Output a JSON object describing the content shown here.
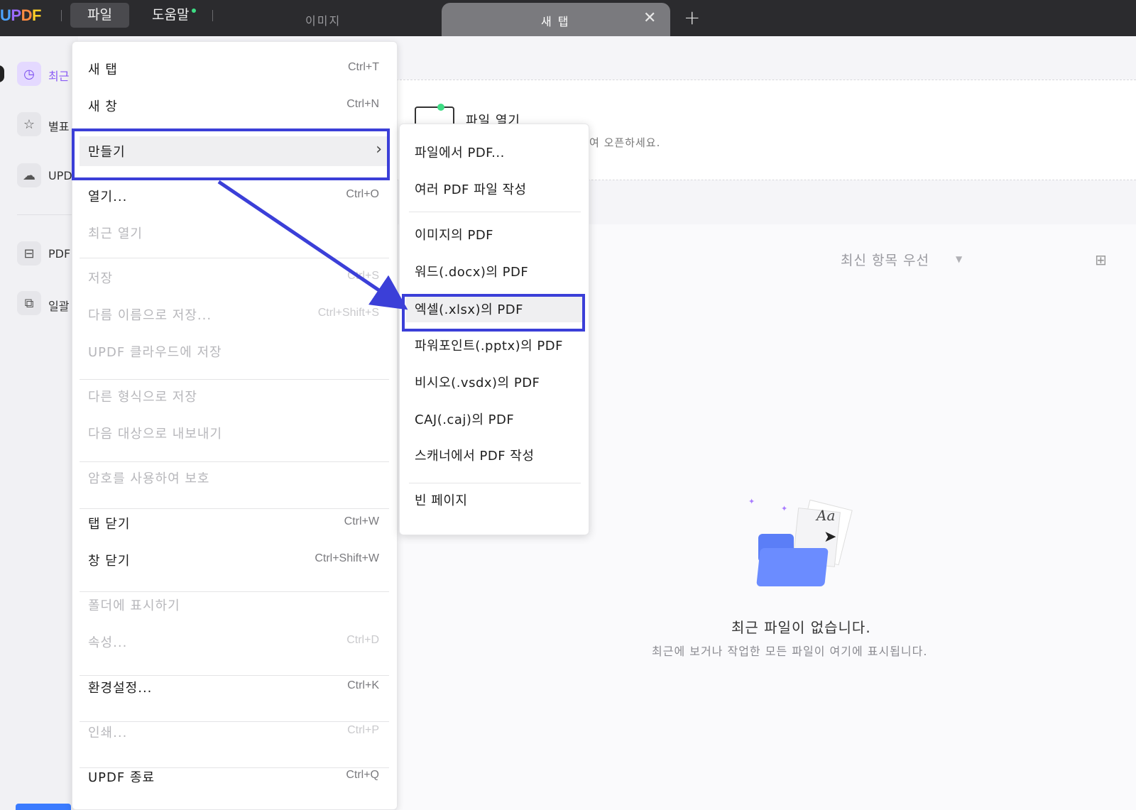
{
  "titlebar": {
    "logo": {
      "u": "U",
      "p": "P",
      "d": "D",
      "f": "F"
    },
    "menus": [
      {
        "label": "파일"
      },
      {
        "label": "도움말"
      }
    ],
    "tabs": [
      {
        "label": "이미지"
      },
      {
        "label": "새 탭"
      }
    ],
    "close_glyph": "✕",
    "add_glyph": "+"
  },
  "sidebar": {
    "items": [
      {
        "label": "최근",
        "icon": "clock-icon"
      },
      {
        "label": "별표",
        "icon": "star-icon"
      },
      {
        "label": "UPD",
        "icon": "cloud-icon"
      },
      {
        "label": "PDF",
        "icon": "briefcase-icon"
      },
      {
        "label": "일괄",
        "icon": "copy-icon"
      }
    ]
  },
  "open_file": {
    "title": "파일 열기",
    "subtitle": "여 오픈하세요."
  },
  "list": {
    "sort_label": "최신 항목 우선",
    "sort_caret": "▼",
    "grid_glyph": "⊞"
  },
  "empty_state": {
    "title": "최근 파일이 없습니다.",
    "subtitle": "최근에 보거나 작업한 모든 파일이 여기에 표시됩니다.",
    "illustration_text": "Aa"
  },
  "file_menu": {
    "items": [
      {
        "label": "새 탭",
        "shortcut": "Ctrl+T"
      },
      {
        "label": "새 창",
        "shortcut": "Ctrl+N"
      },
      {
        "label": "만들기",
        "shortcut": "",
        "arrow": "›"
      },
      {
        "label": "열기...",
        "shortcut": "Ctrl+O"
      },
      {
        "label": "최근 열기",
        "shortcut": ""
      },
      {
        "label": "저장",
        "shortcut": "Ctrl+S"
      },
      {
        "label": "다름 이름으로 저장...",
        "shortcut": "Ctrl+Shift+S"
      },
      {
        "label": "UPDF 클라우드에 저장",
        "shortcut": ""
      },
      {
        "label": "다른 형식으로 저장",
        "shortcut": ""
      },
      {
        "label": "다음 대상으로 내보내기",
        "shortcut": ""
      },
      {
        "label": "암호를 사용하여 보호",
        "shortcut": ""
      },
      {
        "label": "탭 닫기",
        "shortcut": "Ctrl+W"
      },
      {
        "label": "창 닫기",
        "shortcut": "Ctrl+Shift+W"
      },
      {
        "label": "폴더에 표시하기",
        "shortcut": ""
      },
      {
        "label": "속성...",
        "shortcut": "Ctrl+D"
      },
      {
        "label": "환경설정...",
        "shortcut": "Ctrl+K"
      },
      {
        "label": "인쇄...",
        "shortcut": "Ctrl+P"
      },
      {
        "label": "UPDF 종료",
        "shortcut": "Ctrl+Q"
      }
    ]
  },
  "create_submenu": {
    "items": [
      {
        "label": "파일에서 PDF..."
      },
      {
        "label": "여러 PDF 파일 작성"
      },
      {
        "label": "이미지의 PDF"
      },
      {
        "label": "워드(.docx)의 PDF"
      },
      {
        "label": "엑셀(.xlsx)의 PDF"
      },
      {
        "label": "파워포인트(.pptx)의 PDF"
      },
      {
        "label": "비시오(.vsdx)의 PDF"
      },
      {
        "label": "CAJ(.caj)의 PDF"
      },
      {
        "label": "스캐너에서 PDF 작성"
      },
      {
        "label": "빈 페이지"
      }
    ]
  },
  "colors": {
    "annotation": "#3b3fd8",
    "titlebar": "#2b2b2e",
    "accent": "#8a5cf5"
  }
}
